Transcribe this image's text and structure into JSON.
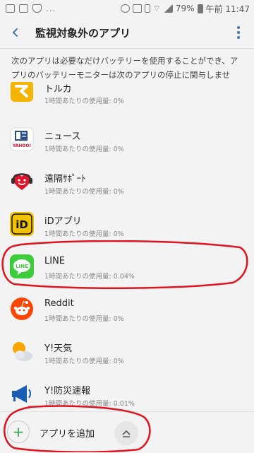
{
  "status_bar": {
    "dots": "...",
    "battery": "79%",
    "time": "午前 11:47"
  },
  "header": {
    "title": "監視対象外のアプリ",
    "back_icon": "back-arrow-icon",
    "menu_icon": "more-vert-icon"
  },
  "description": "次のアプリは必要なだけバッテリーを使用することができ、アプリのバッテリーモニターは次のアプリの停止に関与しません。",
  "apps": [
    {
      "name": "トルカ",
      "usage": "1時間あたりの使用量: 0%",
      "icon": "toruca-icon"
    },
    {
      "name": "ニュース",
      "usage": "1時間あたりの使用量: 0%",
      "icon": "yahoo-news-icon"
    },
    {
      "name": "遠隔ｻﾎﾟｰﾄ",
      "usage": "1時間あたりの使用量: 0%",
      "icon": "remote-support-icon"
    },
    {
      "name": "iDアプリ",
      "usage": "1時間あたりの使用量: 0%",
      "icon": "id-app-icon"
    },
    {
      "name": "LINE",
      "usage": "1時間あたりの使用量: 0.04%",
      "icon": "line-icon"
    },
    {
      "name": "Reddit",
      "usage": "1時間あたりの使用量: 0%",
      "icon": "reddit-icon"
    },
    {
      "name": "Y!天気",
      "usage": "1時間あたりの使用量: 0%",
      "icon": "yahoo-weather-icon"
    },
    {
      "name": "Y!防災速報",
      "usage": "1時間あたりの使用量: 0.01%",
      "icon": "yahoo-disaster-icon"
    }
  ],
  "icon_texts": {
    "yahoo": "YAHOO!",
    "id": "iD",
    "line": "LINE"
  },
  "bottom": {
    "add_label": "アプリを追加",
    "add_icon": "plus-icon",
    "top_icon": "scroll-top-icon"
  },
  "colors": {
    "accent": "#4a78a8",
    "annotation": "#e0141e",
    "line_green": "#3ccc3c",
    "add_green": "#3aa54a"
  }
}
